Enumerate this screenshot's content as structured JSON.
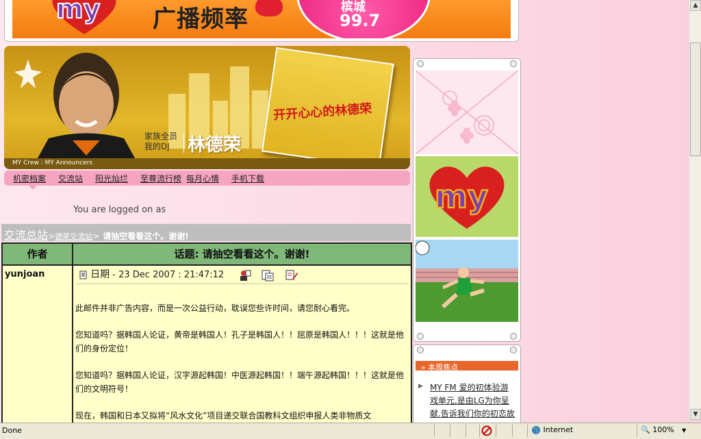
{
  "banner": {
    "title": "广播频率",
    "freq_label": "槟城",
    "freq_value": "99.7"
  },
  "hero": {
    "caption_line1": "家族全员",
    "caption_line2": "我的DJ",
    "dj_name": "林德荣",
    "crew_text": "MY Crew : MY Announcers",
    "magazine_title": "开开心心的林德荣"
  },
  "nav": {
    "items": [
      {
        "label": "机密档案"
      },
      {
        "label": "交流站"
      },
      {
        "label": "阳光灿烂"
      },
      {
        "label": "至尊流行榜"
      },
      {
        "label": "每月心情"
      },
      {
        "label": "手机下载"
      }
    ]
  },
  "login_text": "You are logged on as",
  "breadcrumb": {
    "root": "交流总站",
    "sep1": ">",
    "middle": "德荣交流站",
    "sep2": ">",
    "current": "请抽空看看这个。谢谢!"
  },
  "post_table": {
    "header_author": "作者",
    "header_topic": "话题: 请抽空看看这个。谢谢!",
    "author": "yunjoan",
    "date_label": "日期",
    "date_value": "- 23 Dec 2007 :  21:47:12",
    "paragraphs": [
      "此邮件并非广告内容，而是一次公益行动，耽误您些许时间，请您耐心看完。",
      "您知道吗？据韩国人论证，黄帝是韩国人！孔子是韩国人！！屈原是韩国人！！！这就是他们的身份定位！",
      "您知道吗？据韩国人论证，汉字源起韩国！中医源起韩国！！端午源起韩国！！！这就是他们的文明符号！",
      "现在，韩国和日本又拟将“风水文化”项目递交联合国教科文组织申报人类非物质文"
    ]
  },
  "right_panel": {
    "focus_title": "本周焦点",
    "focus_link": "MY FM 爱的初体验游戏单元,是由LG为你呈献.告诉我们你的初恋故事"
  },
  "status_bar": {
    "text": "Done",
    "zone": "Internet",
    "zoom": "100%"
  },
  "colors": {
    "banner_orange": "#f47b10",
    "hero_gold": "#e2b72a",
    "nav_pink": "#f6a5c0",
    "table_header_green": "#7fb878",
    "post_bg": "#ffffc9",
    "focus_orange": "#e9662a"
  }
}
